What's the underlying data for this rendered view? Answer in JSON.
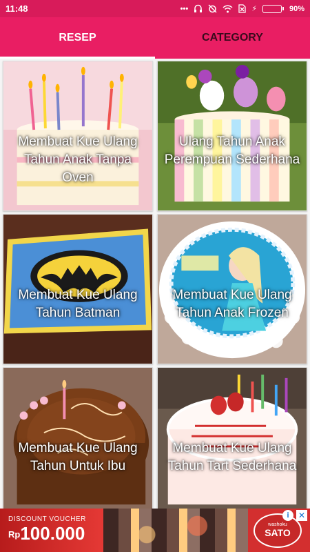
{
  "status": {
    "time": "11:48",
    "battery": "90%",
    "battery_level": 0.9,
    "icons": [
      "more-icon",
      "headset-icon",
      "alarm-off-icon",
      "wifi-icon",
      "sim-x-icon",
      "charging-icon"
    ]
  },
  "tabs": [
    {
      "label": "RESEP",
      "active": true
    },
    {
      "label": "CATEGORY",
      "active": false
    }
  ],
  "recipes": [
    {
      "title": "Membuat Kue Ulang Tahun Anak Tanpa Oven"
    },
    {
      "title": "Ulang Tahun Anak Perempuan Sederhana"
    },
    {
      "title": "Membuat Kue Ulang Tahun Batman"
    },
    {
      "title": "Membuat Kue Ulang Tahun Anak Frozen"
    },
    {
      "title": "Membuat Kue Ulang Tahun Untuk Ibu"
    },
    {
      "title": "Membuat Kue Ulang Tahun Tart Sederhana"
    }
  ],
  "ad": {
    "voucher": "DISCOUNT VOUCHER",
    "currency": "Rp",
    "amount": "100.000",
    "brand_small": "washoku",
    "brand": "SATO"
  },
  "colors": {
    "primary": "#e91e63",
    "status_bar": "#d81b5a"
  }
}
